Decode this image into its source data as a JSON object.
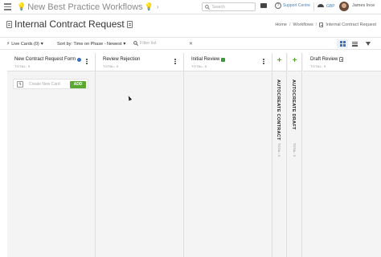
{
  "app": {
    "workspace_title": "New Best Practice Workflows",
    "search_placeholder": "Search",
    "support_label": "Support Centre",
    "currency": "GBP",
    "user_name": "James Ince"
  },
  "page": {
    "title": "Internal Contract Request",
    "breadcrumb": [
      "Home",
      "Workflows",
      "Internal Contract Request"
    ]
  },
  "toolbar": {
    "live_cards": "Live Cards (0)",
    "sort": "Sort by: Time on Phase - Newest",
    "filter_placeholder": "Filter list"
  },
  "columns": [
    {
      "title": "New Contract Request Form",
      "total": "TOTAL: 0"
    },
    {
      "title": "Review Rejection",
      "total": "TOTAL: 0"
    },
    {
      "title": "Initial Review",
      "total": "TOTAL: 0"
    },
    {
      "title": "AUTOCREATE CONTRACT",
      "total": "TOTAL: 0"
    },
    {
      "title": "AUTOCREATE DRAFT",
      "total": "TOTAL: 0"
    },
    {
      "title": "Draft Review",
      "total": "TOTAL: 0"
    }
  ],
  "new_card": {
    "placeholder": "Create New Card",
    "add_label": "ADD"
  },
  "colors": {
    "accent_blue": "#3b6fc0",
    "add_green": "#5aa832"
  }
}
